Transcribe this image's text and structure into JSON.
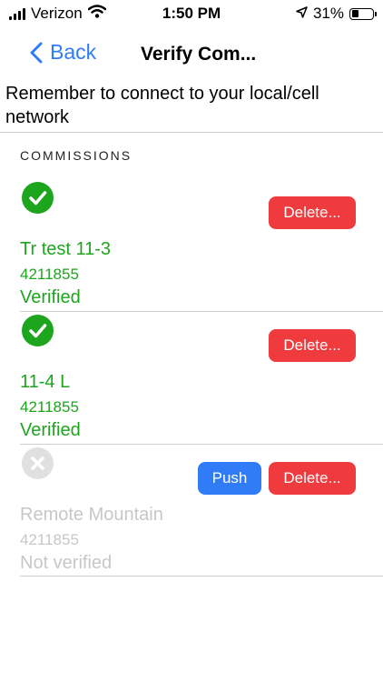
{
  "status_bar": {
    "carrier": "Verizon",
    "time": "1:50 PM",
    "battery": "31%",
    "battery_level": 0.31,
    "icons": [
      "signal-icon",
      "wifi-icon",
      "location-arrow-icon",
      "battery-icon"
    ]
  },
  "nav": {
    "back_label": "Back",
    "title": "Verify Com..."
  },
  "notice": "Remember to connect to your local/cell network",
  "section_header": "COMMISSIONS",
  "colors": {
    "accent": "#2f7cf6",
    "verified": "#1ea51e",
    "delete": "#ef3a3e",
    "disabled": "#c7c7c9"
  },
  "commissions": [
    {
      "name": "Tr test 11-3",
      "code": "4211855",
      "status": "Verified",
      "icon": "check-circle-icon",
      "delete_label": "Delete..."
    },
    {
      "name": "11-4 L",
      "code": "4211855",
      "status": "Verified",
      "icon": "check-circle-icon",
      "delete_label": "Delete..."
    },
    {
      "name": "Remote Mountain",
      "code": "4211855",
      "status": "Not verified",
      "icon": "x-circle-icon",
      "push_label": "Push",
      "delete_label": "Delete..."
    }
  ]
}
